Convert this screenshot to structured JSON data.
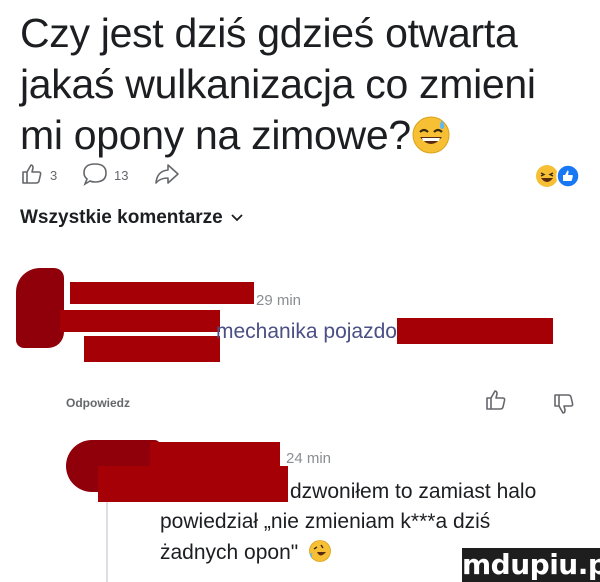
{
  "post": {
    "line1": "Czy jest dziś gdzieś otwarta",
    "line2": "jakaś wulkanizacja co zmieni",
    "line3": "mi opony na zimowe?",
    "emoji": "grinning-sweat-emoji"
  },
  "actions": {
    "like_count": "3",
    "comment_count": "13",
    "like_icon": "thumbs-up-icon",
    "comment_icon": "comment-bubble-icon",
    "share_icon": "share-arrow-icon",
    "reaction_icons": [
      "haha-reaction-icon",
      "like-reaction-icon"
    ]
  },
  "comments_header": {
    "label": "Wszystkie komentarze",
    "icon": "chevron-down-icon"
  },
  "comments": [
    {
      "time": "29 min",
      "text_fragment": "mechanika pojazdo",
      "reply_label": "Odpowiedz"
    },
    {
      "time": "24 min",
      "line1": "dzwoniłem to zamiast halo",
      "line2": "powiedział „nie zmieniam k***a dziś",
      "line3": "żadnych opon\"",
      "emoji": "rofl-emoji"
    }
  ],
  "watermark": "mdupiu.pl",
  "colors": {
    "text": "#1c1e21",
    "meta": "#8a8d91",
    "like_blue": "#1877f2",
    "reaction_yellow": "#f7c034",
    "redaction": "#a50006"
  }
}
